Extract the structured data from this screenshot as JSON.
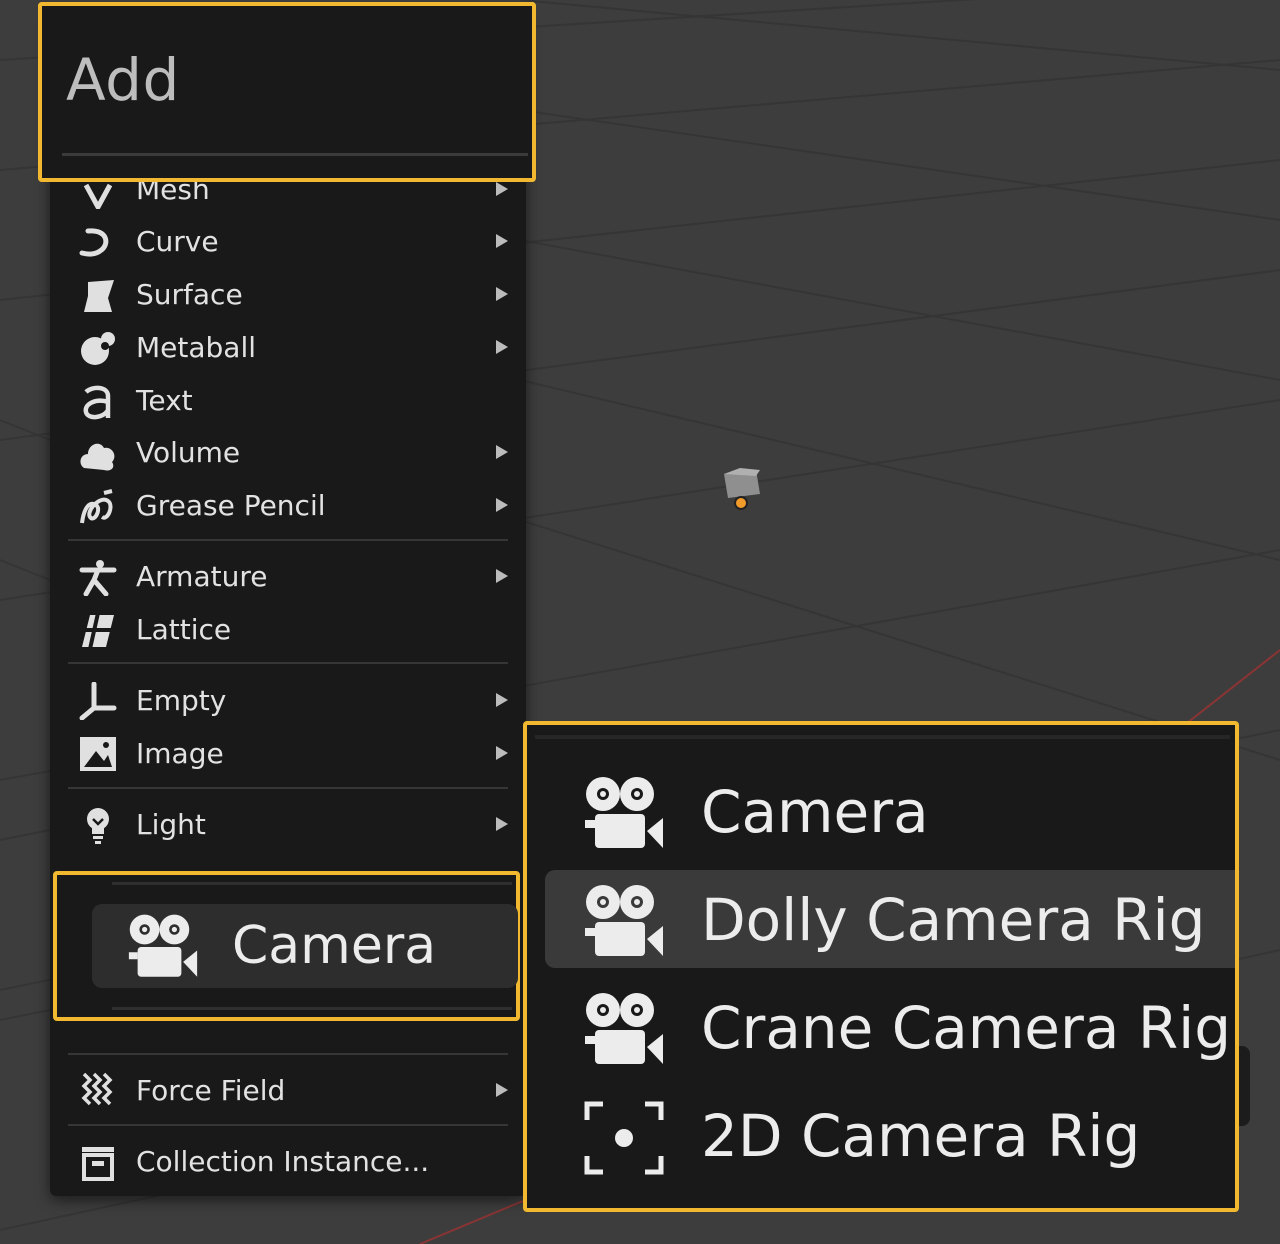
{
  "menu": {
    "title": "Add",
    "items": [
      {
        "label": "Mesh",
        "icon": "mesh-icon",
        "has_submenu": true
      },
      {
        "label": "Curve",
        "icon": "curve-icon",
        "has_submenu": true
      },
      {
        "label": "Surface",
        "icon": "surface-icon",
        "has_submenu": true
      },
      {
        "label": "Metaball",
        "icon": "metaball-icon",
        "has_submenu": true
      },
      {
        "label": "Text",
        "icon": "text-icon",
        "has_submenu": false
      },
      {
        "label": "Volume",
        "icon": "volume-icon",
        "has_submenu": true
      },
      {
        "label": "Grease Pencil",
        "icon": "grease-pencil-icon",
        "has_submenu": true
      },
      {
        "label": "Armature",
        "icon": "armature-icon",
        "has_submenu": true
      },
      {
        "label": "Lattice",
        "icon": "lattice-icon",
        "has_submenu": false
      },
      {
        "label": "Empty",
        "icon": "empty-icon",
        "has_submenu": true
      },
      {
        "label": "Image",
        "icon": "image-icon",
        "has_submenu": true
      },
      {
        "label": "Light",
        "icon": "light-icon",
        "has_submenu": true
      },
      {
        "label": "Camera",
        "icon": "camera-icon",
        "has_submenu": true,
        "highlighted": true
      },
      {
        "label": "Force Field",
        "icon": "force-field-icon",
        "has_submenu": true
      },
      {
        "label": "Collection Instance...",
        "icon": "collection-instance-icon",
        "has_submenu": false
      }
    ]
  },
  "camera_submenu": {
    "items": [
      {
        "label": "Camera",
        "icon": "camera-icon"
      },
      {
        "label": "Dolly Camera Rig",
        "icon": "camera-icon",
        "active": true
      },
      {
        "label": "Crane Camera Rig",
        "icon": "camera-icon"
      },
      {
        "label": "2D Camera Rig",
        "icon": "camera-2d-icon"
      }
    ]
  },
  "colors": {
    "highlight_border": "#f2b930",
    "menu_bg": "#191919",
    "viewport_bg": "#3d3d3d",
    "origin_dot": "#f29b2b"
  }
}
